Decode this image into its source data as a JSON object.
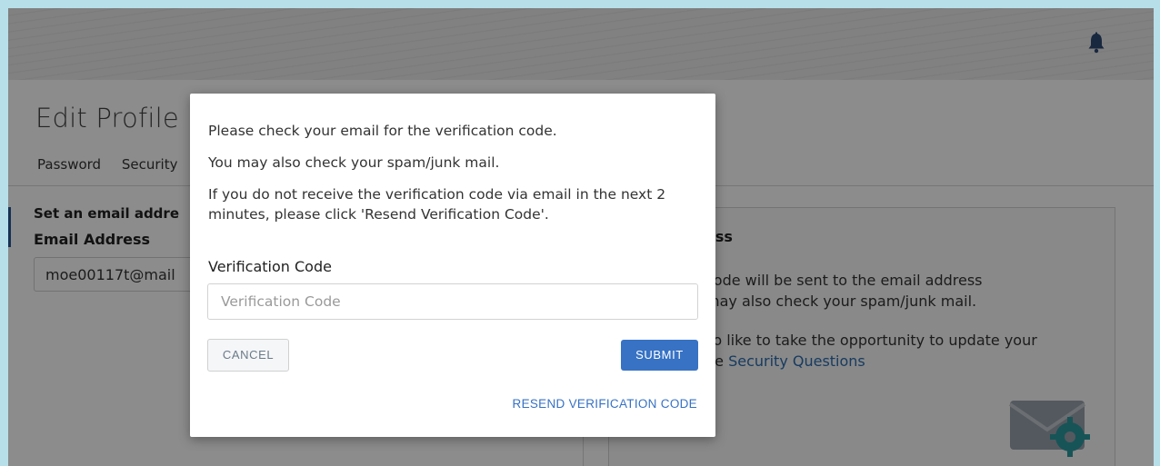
{
  "header": {
    "notification_icon": "bell-icon"
  },
  "page": {
    "title": "Edit Profile",
    "tabs": [
      {
        "label": "Password"
      },
      {
        "label": "Security"
      }
    ],
    "email_section": {
      "title": "Set an email addre",
      "field_label": "Email Address",
      "field_value": "moe00117t@mail"
    },
    "info_card": {
      "title": "ess",
      "paragraph1": "code will be sent to the email address\nmay also check your spam/junk mail.",
      "paragraph2_text": "so like to take the opportunity to update your\nhe ",
      "paragraph2_link": "Security Questions",
      "icon": "mail-gear-icon"
    }
  },
  "modal": {
    "message1": "Please check your email for the verification code.",
    "message2": "You may also check your spam/junk mail.",
    "message3": "If you do not receive the verification code via email in the next 2 minutes, please click 'Resend Verification Code'.",
    "code_label": "Verification Code",
    "code_placeholder": "Verification Code",
    "code_value": "",
    "cancel_label": "CANCEL",
    "submit_label": "SUBMIT",
    "resend_label": "RESEND VERIFICATION CODE"
  },
  "colors": {
    "primary": "#3772c4",
    "link": "#2b6cb0",
    "outer_border": "#b7dfe9",
    "header_bg": "#ececec",
    "accent_bar": "#2b5a9a"
  }
}
